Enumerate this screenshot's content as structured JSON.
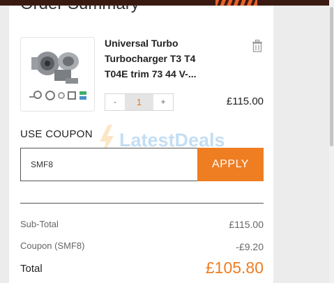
{
  "heading": "Order Summary",
  "item": {
    "name_lines": [
      "Universal Turbo",
      "Turbocharger T3 T4",
      "T04E trim 73 44 V-..."
    ],
    "quantity": "1",
    "decrement_label": "-",
    "increment_label": "+",
    "price": "£115.00"
  },
  "coupon": {
    "title": "USE COUPON",
    "code": "SMF8",
    "apply_label": "APPLY",
    "watermark": "LatestDeals"
  },
  "totals": {
    "subtotal_label": "Sub-Total",
    "subtotal_value": "£115.00",
    "coupon_label": "Coupon (SMF8)",
    "coupon_value": "-£9.20",
    "total_label": "Total",
    "total_value": "£105.80"
  },
  "colors": {
    "accent": "#ef7d22",
    "quantity_bg": "#e4e4e4"
  },
  "icons": {
    "delete": "trash-icon",
    "product": "turbocharger-image",
    "watermark": "lightning-bolt-icon"
  }
}
